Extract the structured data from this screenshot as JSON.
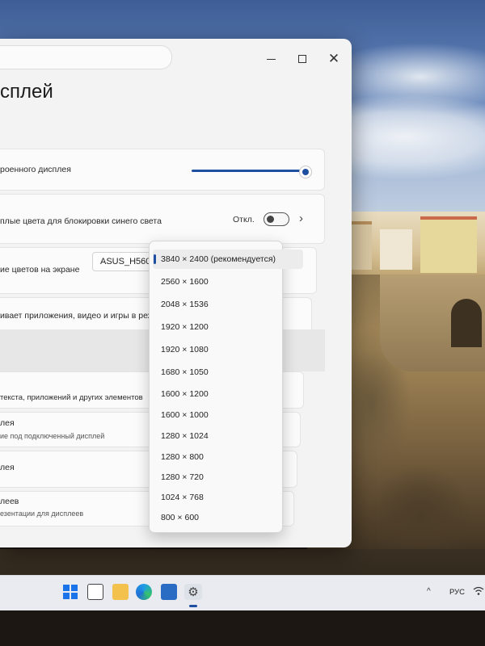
{
  "window": {
    "page_title": "сплей",
    "controls": {
      "minimize": "—",
      "maximize": "□",
      "close": "✕"
    }
  },
  "rows": {
    "brightness_label": "роенного дисплея",
    "brightness_level": 0.95,
    "night_light_label": "плые цвета для блокировки синего света",
    "night_light_state": "Откл.",
    "color_profile_label": "ие цветов на экране",
    "color_profile_value": "ASUS_H5600",
    "hdr_label": "ивает приложения, видео и игры в режиме",
    "scale_label": "текста, приложений и других элементов",
    "resolution_title": "лея",
    "resolution_sub": "ие под подключенный дисплей",
    "orientation_title": "лея",
    "multiple_title": "леев",
    "multiple_sub": "езентации для дисплеев"
  },
  "resolution_dropdown": {
    "selected_index": 0,
    "options": [
      "3840 × 2400 (рекомендуется)",
      "2560 × 1600",
      "2048 × 1536",
      "1920 × 1200",
      "1920 × 1080",
      "1680 × 1050",
      "1600 × 1200",
      "1600 × 1000",
      "1280 × 1024",
      "1280 × 800",
      "1280 × 720",
      "1024 × 768",
      "800 × 600"
    ]
  },
  "taskbar": {
    "icons": [
      "windows-start-icon",
      "task-view-icon",
      "file-explorer-icon",
      "edge-icon",
      "microsoft-store-icon",
      "settings-gear-icon"
    ],
    "language": "РУС"
  },
  "colors": {
    "accent": "#1f4fa0",
    "window_bg": "#f3f3f3",
    "card_bg": "#fbfbfb"
  }
}
